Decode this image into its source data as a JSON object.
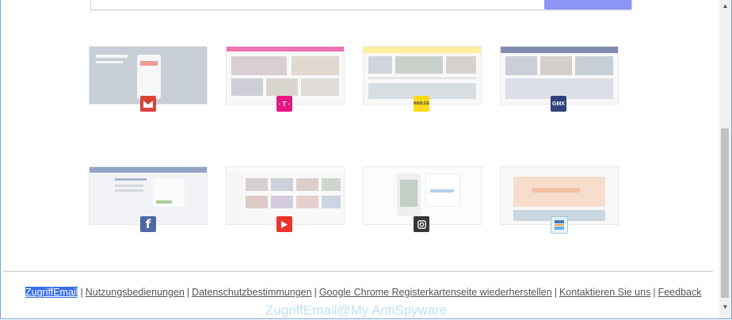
{
  "tiles": [
    {
      "name": "gmail",
      "icon": "gmail-icon",
      "color": "#d93025"
    },
    {
      "name": "telekom",
      "icon": "telekom-icon",
      "color": "#e20074",
      "badge_text": "· T ·"
    },
    {
      "name": "web-de",
      "icon": "web-de-icon",
      "color": "#ffd800",
      "badge_text": "WEB.DE"
    },
    {
      "name": "gmx",
      "icon": "gmx-icon",
      "color": "#1c2f6e",
      "badge_text": "GMX"
    },
    {
      "name": "facebook",
      "icon": "facebook-icon",
      "color": "#3b5998"
    },
    {
      "name": "youtube",
      "icon": "youtube-icon",
      "color": "#e62117"
    },
    {
      "name": "instagram",
      "icon": "instagram-icon",
      "color": "#222222"
    },
    {
      "name": "aldi-reisen",
      "icon": "aldi-icon",
      "color": "#e9f3fb"
    }
  ],
  "footer": {
    "links": [
      "ZugriffEmail",
      "Nutzungsbedienungen",
      "Datenschutzbestimmungen",
      "Google Chrome Registerkartenseite wiederherstellen",
      "Kontaktieren Sie uns",
      "Feedback"
    ],
    "separator": "|"
  },
  "watermark": "ZugriffEmail@My AntiSpyware",
  "colors": {
    "search_button": "#8c95f5",
    "highlight": "#3a6ee8",
    "frame_border": "#7aa7d3"
  }
}
